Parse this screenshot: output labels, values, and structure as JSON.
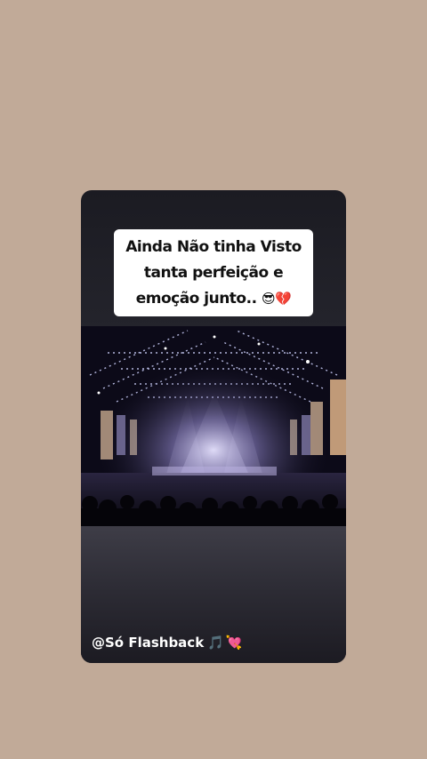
{
  "story": {
    "caption_lines": [
      "Ainda Não tinha Visto",
      "tanta perfeição e",
      "emoção junto.."
    ],
    "caption_emojis": [
      "😎",
      "💔"
    ],
    "handle": "@Só Flashback",
    "handle_emojis": [
      "🎵",
      "💘"
    ]
  },
  "colors": {
    "background": "#c1aa98",
    "card": "#1d1d24",
    "caption_bg": "#ffffff"
  }
}
